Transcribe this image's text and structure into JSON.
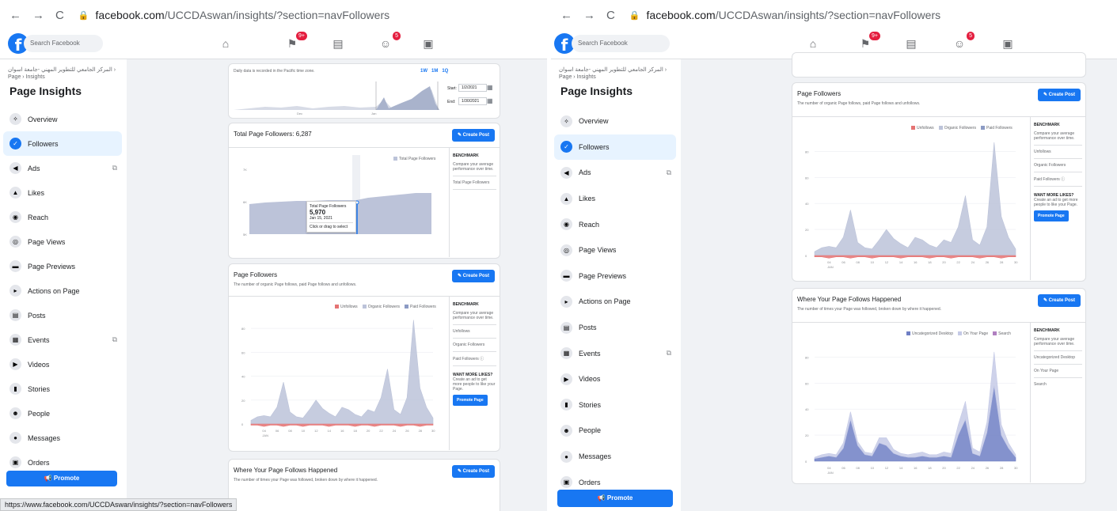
{
  "browser": {
    "url_host": "facebook.com",
    "url_path": "/UCCDAswan/insights/?section=navFollowers",
    "status_url": "https://www.facebook.com/UCCDAswan/insights/?section=navFollowers"
  },
  "facebook": {
    "logo": "f",
    "search_placeholder": "Search Facebook",
    "badges": {
      "flag": "9+",
      "groups": "5"
    }
  },
  "sidebar": {
    "breadcrumb": "المركز الجامعي للتطوير المهني -جامعة اسوان › Page › Insights",
    "title": "Page Insights",
    "items": [
      {
        "label": "Overview",
        "icon": "sparkle-icon",
        "glyph": "✧"
      },
      {
        "label": "Followers",
        "icon": "followers-icon",
        "glyph": "✓"
      },
      {
        "label": "Ads",
        "icon": "megaphone-icon",
        "glyph": "◀",
        "external": true
      },
      {
        "label": "Likes",
        "icon": "like-icon",
        "glyph": "▲"
      },
      {
        "label": "Reach",
        "icon": "reach-icon",
        "glyph": "◉"
      },
      {
        "label": "Page Views",
        "icon": "eye-icon",
        "glyph": "◎"
      },
      {
        "label": "Page Previews",
        "icon": "preview-icon",
        "glyph": "▬"
      },
      {
        "label": "Actions on Page",
        "icon": "cursor-icon",
        "glyph": "▸"
      },
      {
        "label": "Posts",
        "icon": "posts-icon",
        "glyph": "▤"
      },
      {
        "label": "Events",
        "icon": "calendar-icon",
        "glyph": "▦",
        "external": true
      },
      {
        "label": "Videos",
        "icon": "video-icon",
        "glyph": "▶"
      },
      {
        "label": "Stories",
        "icon": "stories-icon",
        "glyph": "▮"
      },
      {
        "label": "People",
        "icon": "people-icon",
        "glyph": "☻"
      },
      {
        "label": "Messages",
        "icon": "messages-icon",
        "glyph": "●"
      },
      {
        "label": "Orders",
        "icon": "orders-icon",
        "glyph": "▣"
      }
    ],
    "promote_label": "Promote",
    "promote_icon": "📢"
  },
  "date_card": {
    "note": "Daily data is recorded in the Pacific time zone.",
    "ranges": [
      "1W",
      "1M",
      "1Q"
    ],
    "start_label": "Start:",
    "start_value": "1/2/2021",
    "end_label": "End:",
    "end_value": "1/30/2021",
    "mini_ticks": [
      "Dec",
      "Jan"
    ]
  },
  "total_card": {
    "title": "Total Page Followers: 6,287",
    "create_post": "Create Post",
    "legend": "Total Page Followers",
    "y_ticks": [
      "7K",
      "6K",
      "5K"
    ],
    "tooltip": {
      "label": "Total Page Followers",
      "value": "5,970",
      "date": "Jan 15, 2021",
      "hint": "Click or drag to select"
    },
    "benchmark": {
      "title": "BENCHMARK",
      "desc": "Compare your average performance over time.",
      "row": "Total Page Followers"
    }
  },
  "followers_card": {
    "title": "Page Followers",
    "subtitle": "The number of organic Page follows, paid Page follows and unfollows.",
    "create_post": "Create Post",
    "legend": [
      "Unfollows",
      "Organic Followers",
      "Paid Followers"
    ],
    "legend_colors": [
      "#e57373",
      "#bcc3d9",
      "#8c9bc4"
    ],
    "y_ticks": [
      "80",
      "60",
      "40",
      "20",
      "0"
    ],
    "benchmark": {
      "title": "BENCHMARK",
      "desc": "Compare your average performance over time.",
      "rows": [
        "Unfollows",
        "Organic Followers",
        "Paid Followers"
      ]
    },
    "more_likes": {
      "title": "WANT MORE LIKES?",
      "desc": "Create an ad to get more people to like your Page.",
      "button": "Promote Page"
    },
    "chart_data": {
      "type": "area",
      "x": [
        "Jan 2",
        "Jan 3",
        "Jan 4",
        "Jan 5",
        "Jan 6",
        "Jan 7",
        "Jan 8",
        "Jan 9",
        "Jan 10",
        "Jan 11",
        "Jan 12",
        "Jan 13",
        "Jan 14",
        "Jan 15",
        "Jan 16",
        "Jan 17",
        "Jan 18",
        "Jan 19",
        "Jan 20",
        "Jan 21",
        "Jan 22",
        "Jan 23",
        "Jan 24",
        "Jan 25",
        "Jan 26",
        "Jan 27",
        "Jan 28",
        "Jan 29",
        "Jan 30"
      ],
      "series": [
        {
          "name": "Organic Followers",
          "values": [
            3,
            6,
            7,
            6,
            14,
            35,
            10,
            6,
            5,
            12,
            20,
            13,
            9,
            6,
            14,
            12,
            8,
            6,
            12,
            10,
            22,
            46,
            12,
            8,
            22,
            87,
            30,
            14,
            5
          ]
        },
        {
          "name": "Unfollows",
          "values": [
            -1,
            -1,
            -2,
            -1,
            -1,
            -2,
            -1,
            -1,
            -2,
            -1,
            -1,
            -1,
            -2,
            -1,
            -1,
            -1,
            -2,
            -1,
            -1,
            -2,
            -1,
            -1,
            -1,
            -2,
            -1,
            -1,
            -2,
            -1,
            -1
          ]
        }
      ],
      "ylim": [
        0,
        90
      ]
    }
  },
  "where_card": {
    "title": "Where Your Page Follows Happened",
    "subtitle": "The number of times your Page was followed, broken down by where it happened.",
    "create_post": "Create Post",
    "legend": [
      "Uncategorized Desktop",
      "On Your Page",
      "Search"
    ],
    "legend_colors": [
      "#6f7fc4",
      "#c5cae6",
      "#b07fc0"
    ],
    "y_ticks": [
      "80",
      "60",
      "40",
      "20",
      "0"
    ],
    "benchmark": {
      "title": "BENCHMARK",
      "desc": "Compare your average performance over time.",
      "rows": [
        "Uncategorized Desktop",
        "On Your Page",
        "Search"
      ]
    },
    "chart_data": {
      "type": "area",
      "x": [
        "Jan 2",
        "Jan 3",
        "Jan 4",
        "Jan 5",
        "Jan 6",
        "Jan 7",
        "Jan 8",
        "Jan 9",
        "Jan 10",
        "Jan 11",
        "Jan 12",
        "Jan 13",
        "Jan 14",
        "Jan 15",
        "Jan 16",
        "Jan 17",
        "Jan 18",
        "Jan 19",
        "Jan 20",
        "Jan 21",
        "Jan 22",
        "Jan 23",
        "Jan 24",
        "Jan 25",
        "Jan 26",
        "Jan 27",
        "Jan 28",
        "Jan 29",
        "Jan 30"
      ],
      "series": [
        {
          "name": "Uncategorized Desktop",
          "values": [
            2,
            3,
            4,
            3,
            10,
            32,
            12,
            5,
            4,
            14,
            12,
            6,
            4,
            3,
            3,
            4,
            3,
            3,
            4,
            3,
            20,
            32,
            6,
            4,
            22,
            58,
            20,
            10,
            3
          ]
        },
        {
          "name": "On Your Page",
          "values": [
            1,
            2,
            2,
            2,
            4,
            6,
            3,
            2,
            2,
            4,
            6,
            3,
            2,
            2,
            3,
            3,
            2,
            2,
            3,
            3,
            8,
            14,
            4,
            3,
            8,
            26,
            8,
            4,
            2
          ]
        }
      ],
      "ylim": [
        0,
        90
      ]
    },
    "x_ticks": [
      "04",
      "06",
      "08",
      "10",
      "12",
      "14",
      "16",
      "18",
      "20",
      "22",
      "24",
      "26",
      "28",
      "30"
    ],
    "x_month": "JAN"
  }
}
